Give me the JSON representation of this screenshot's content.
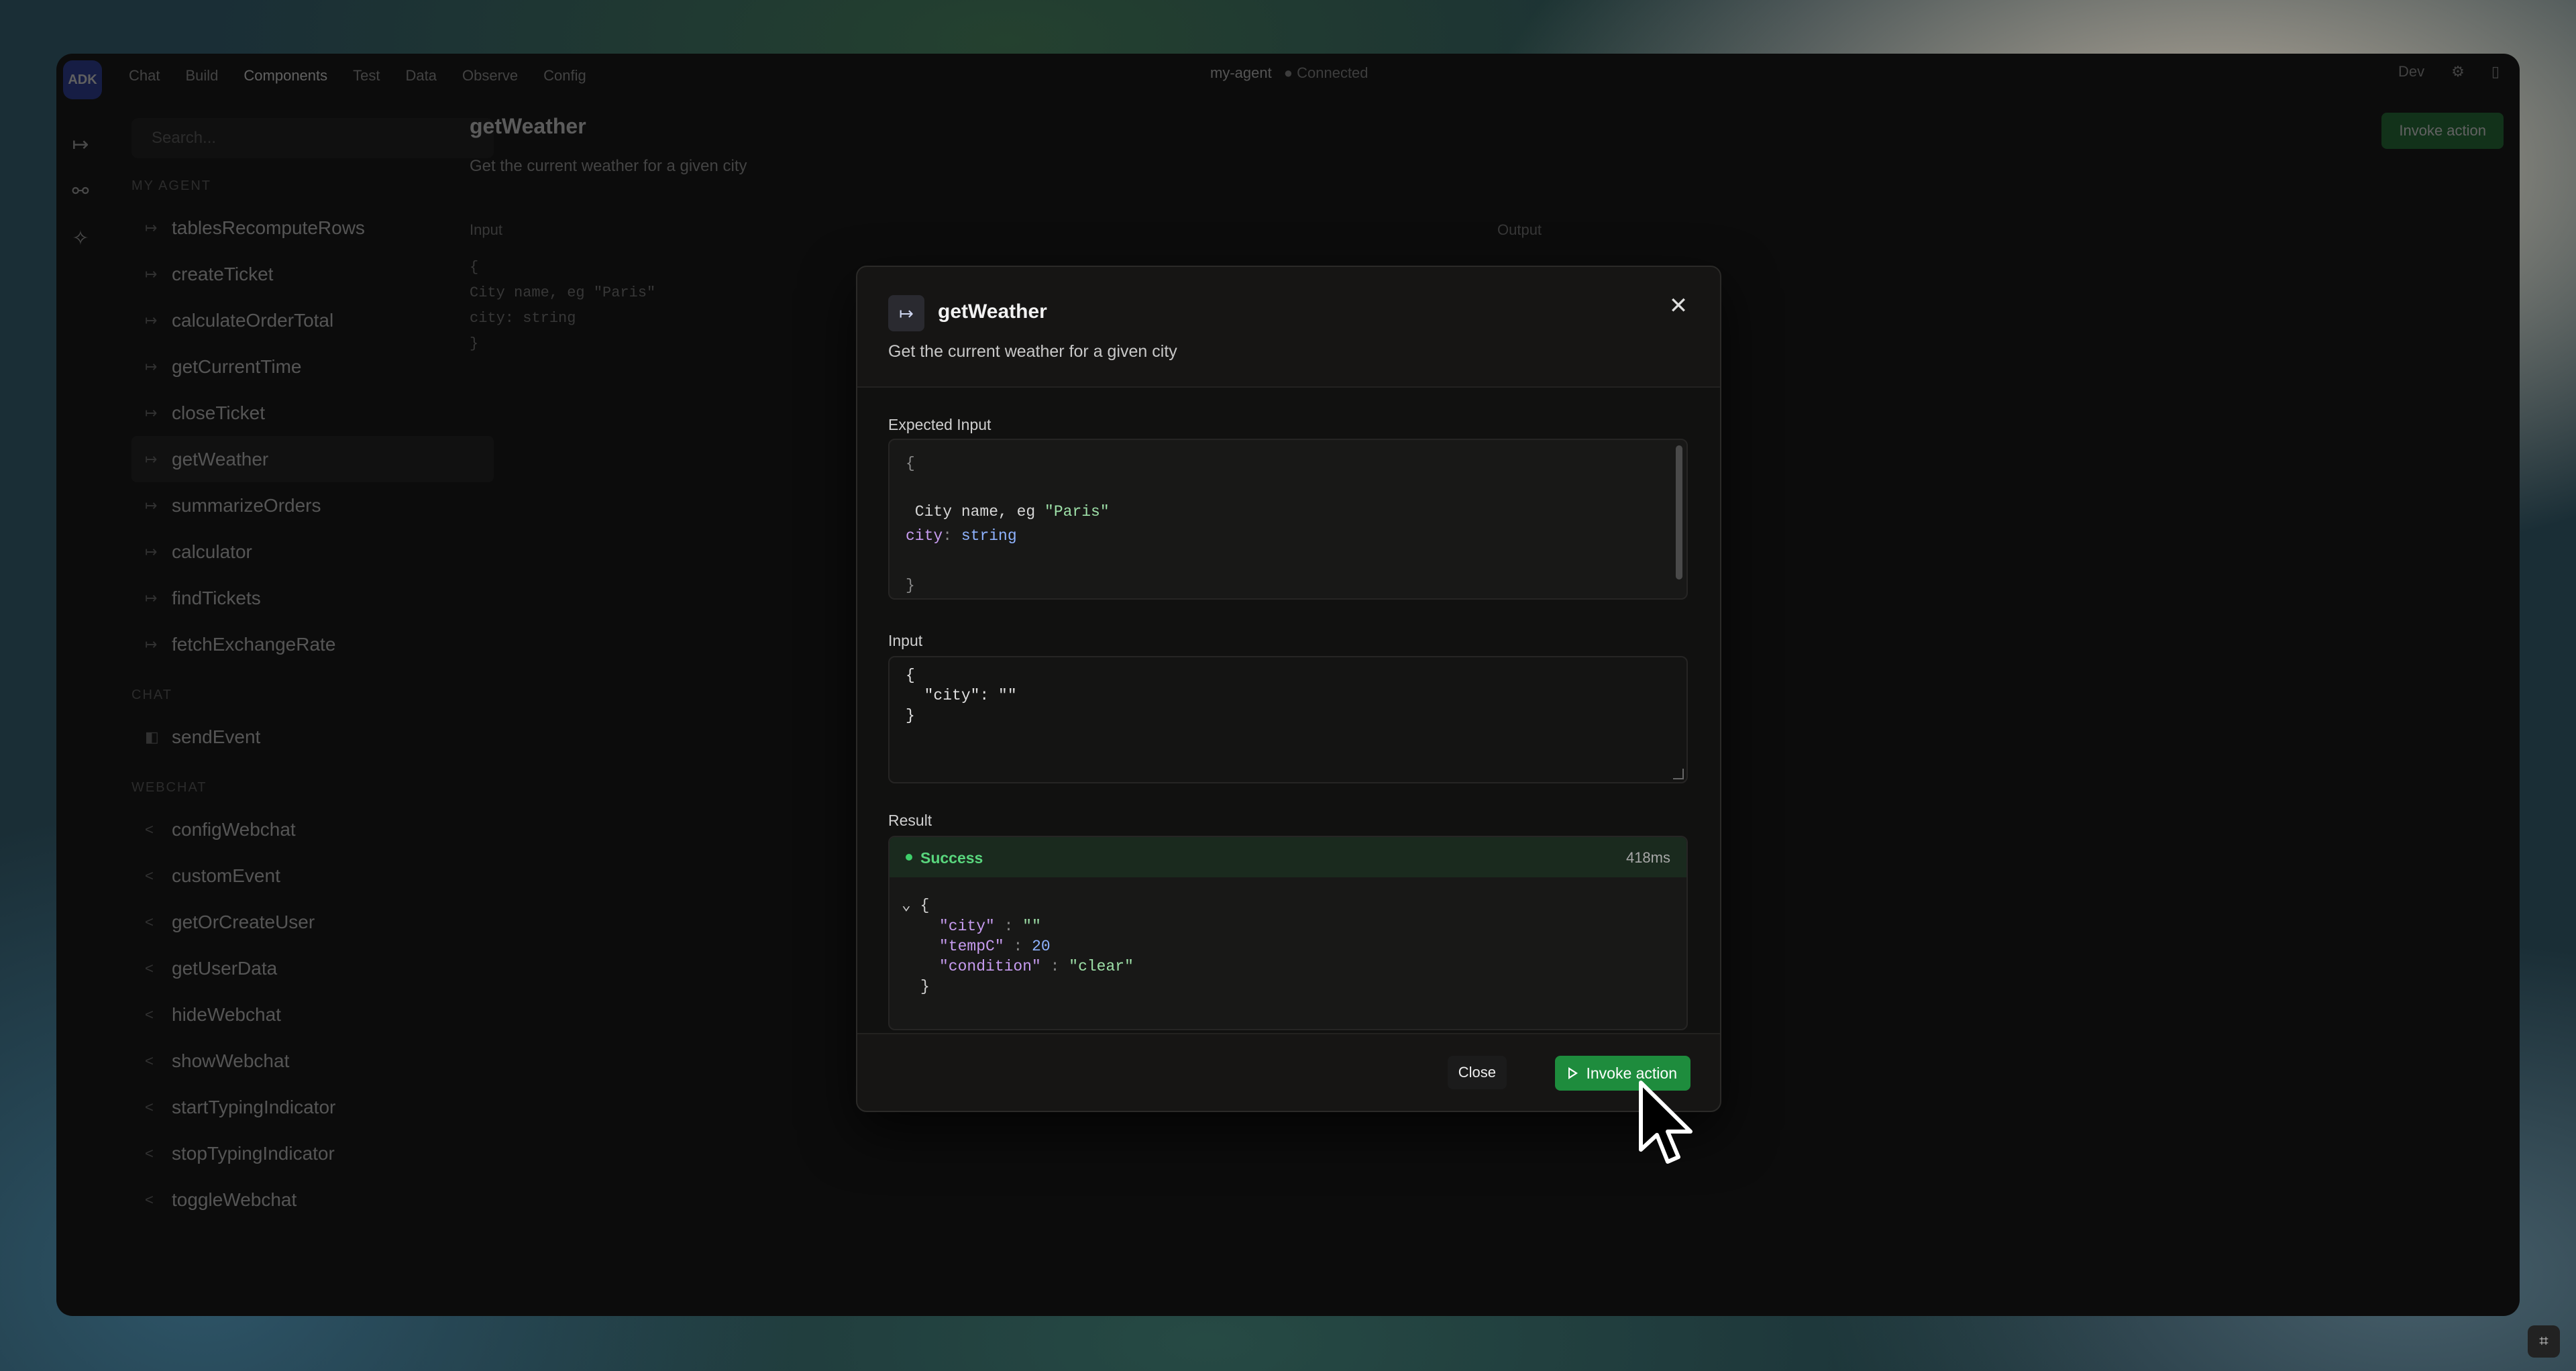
{
  "topbar": {
    "logo": "ADK",
    "nav": [
      "Chat",
      "Build",
      "Components",
      "Test",
      "Data",
      "Observe",
      "Config"
    ],
    "active_nav": "Components",
    "agent_name": "my-agent",
    "agent_status": "● Connected",
    "env": "Dev"
  },
  "sidebar": {
    "search_placeholder": "Search...",
    "sections": [
      {
        "title": "MY AGENT",
        "items": [
          "tablesRecomputeRows",
          "createTicket",
          "calculateOrderTotal",
          "getCurrentTime",
          "closeTicket",
          "getWeather",
          "summarizeOrders",
          "calculator",
          "findTickets",
          "fetchExchangeRate"
        ]
      },
      {
        "title": "CHAT",
        "items": [
          "sendEvent"
        ]
      },
      {
        "title": "WEBCHAT",
        "items": [
          "configWebchat",
          "customEvent",
          "getOrCreateUser",
          "getUserData",
          "hideWebchat",
          "showWebchat",
          "startTypingIndicator",
          "stopTypingIndicator",
          "toggleWebchat"
        ]
      }
    ],
    "selected": "getWeather"
  },
  "main": {
    "title": "getWeather",
    "description": "Get the current weather for a given city",
    "input_label": "Input",
    "output_label": "Output",
    "invoke_label": "Invoke action",
    "code_lines": [
      "{",
      "",
      " City name, eg \"Paris\"",
      "city: string",
      "",
      "}"
    ]
  },
  "modal": {
    "icon": "action-icon",
    "title": "getWeather",
    "description": "Get the current weather for a given city",
    "expected_input_label": "Expected Input",
    "expected": {
      "open": "{",
      "comment_pre": " City name, eg ",
      "comment_str": "\"Paris\"",
      "key": "city",
      "colon": ":",
      "type": "string",
      "close": "}"
    },
    "input_label": "Input",
    "input_lines": [
      "{",
      "  \"city\": \"\"",
      "}"
    ],
    "result_label": "Result",
    "result": {
      "status": "Success",
      "time": "418ms",
      "toggle": "⌄",
      "open": "{",
      "city_key": "\"city\"",
      "city_val": "\"\"",
      "temp_key": "\"tempC\"",
      "temp_val": "20",
      "cond_key": "\"condition\"",
      "cond_val": "\"clear\"",
      "sep": ":",
      "close": "}"
    },
    "close_label": "Close",
    "invoke_label": "Invoke action"
  },
  "colors": {
    "accent_green": "#1e8c3d",
    "success_text": "#59d67d",
    "brand_blue": "#2b3fae"
  }
}
